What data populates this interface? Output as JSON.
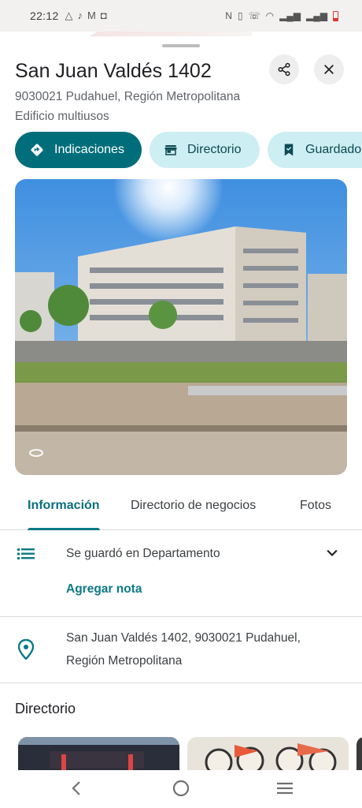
{
  "status_bar": {
    "time": "22:12",
    "notification_icons": [
      "triangle-app-icon",
      "tiktok-icon",
      "gmail-icon",
      "cast-icon"
    ],
    "system_icons": [
      "nfc-icon",
      "vibrate-icon",
      "wifi-call-icon",
      "wifi-icon",
      "signal-icon",
      "signal-icon",
      "battery-low-icon"
    ],
    "battery_color": "#d33333"
  },
  "place": {
    "title": "San Juan Valdés 1402",
    "address_line": "9030021 Pudahuel, Región Metropolitana",
    "category": "Edificio multiusos"
  },
  "chips": {
    "directions": "Indicaciones",
    "directory": "Directorio",
    "saved": "Guardado"
  },
  "tabs": {
    "info": "Información",
    "business_directory": "Directorio de negocios",
    "photos": "Fotos"
  },
  "saved_row": {
    "text": "Se guardó en Departamento",
    "add_note": "Agregar nota"
  },
  "address_row": {
    "line1": "San Juan Valdés 1402, 9030021 Pudahuel,",
    "line2": "Región Metropolitana"
  },
  "directory_section": {
    "heading": "Directorio"
  },
  "colors": {
    "accent": "#006e7a",
    "chip_secondary": "#cdeff3",
    "link": "#0b7a86"
  }
}
